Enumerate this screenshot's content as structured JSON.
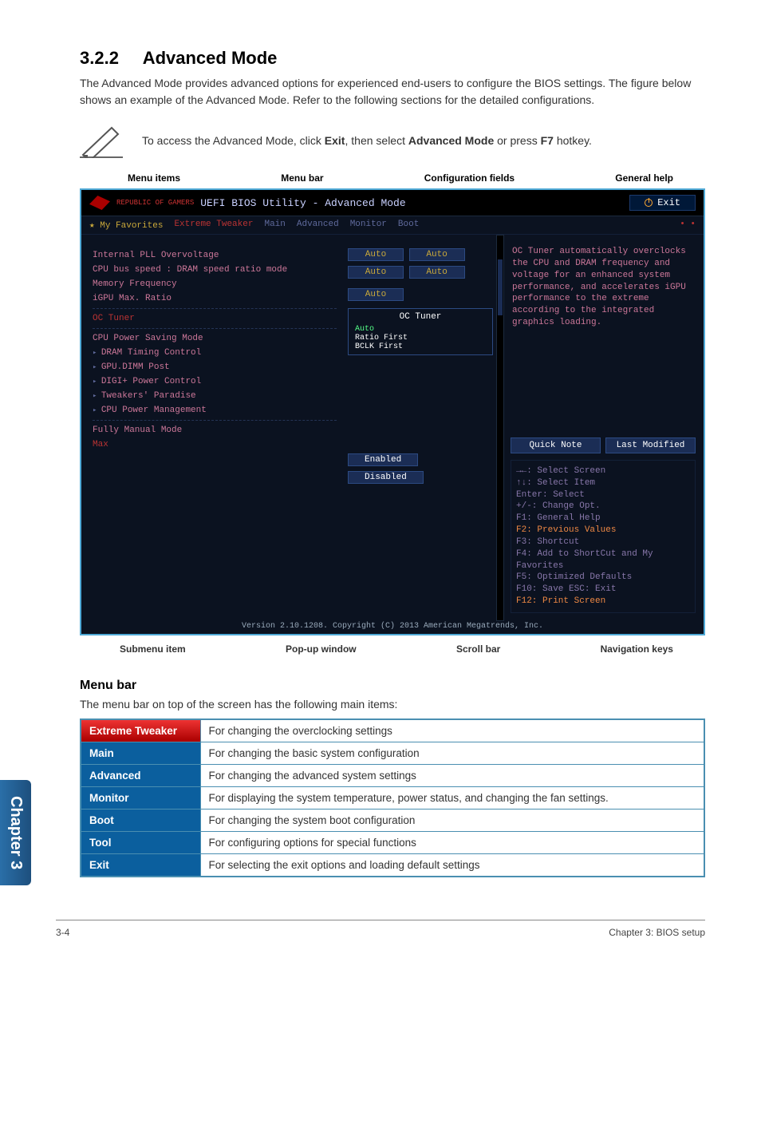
{
  "section_number": "3.2.2",
  "section_title": "Advanced Mode",
  "intro": "The Advanced Mode provides advanced options for experienced end-users to configure the BIOS settings. The figure below shows an example of the Advanced Mode. Refer to the following sections for the detailed configurations.",
  "note": "To access the Advanced Mode, click Exit, then select Advanced Mode or press F7 hotkey.",
  "top_labels": {
    "menu_items": "Menu items",
    "menu_bar": "Menu bar",
    "config_fields": "Configuration fields",
    "general_help": "General help"
  },
  "bios": {
    "brand_small": "REPUBLIC OF\nGAMERS",
    "title": "UEFI BIOS Utility - Advanced Mode",
    "exit": "Exit",
    "menubar": [
      "★ My Favorites",
      "Extreme Tweaker",
      "Main",
      "Advanced",
      "Monitor",
      "Boot"
    ],
    "left_items": [
      "Internal PLL Overvoltage",
      "CPU bus speed : DRAM speed ratio mode",
      "Memory Frequency",
      "iGPU Max. Ratio"
    ],
    "oc_tuner_label": "OC Tuner",
    "cpu_saving": "CPU Power Saving Mode",
    "sub_items": [
      "DRAM Timing Control",
      "GPU.DIMM Post",
      "DIGI+ Power Control",
      "Tweakers' Paradise",
      "CPU Power Management"
    ],
    "fully_manual": "Fully Manual Mode",
    "max_label": "Max",
    "pills": [
      "Auto",
      "Auto",
      "Auto",
      "Auto",
      "Auto"
    ],
    "popup_title": "OC Tuner",
    "popup_lines": [
      "Auto",
      "Ratio First",
      "BCLK First"
    ],
    "enabled": "Enabled",
    "disabled": "Disabled",
    "help_text": "OC Tuner automatically overclocks the CPU and DRAM frequency and voltage for an enhanced system performance, and accelerates iGPU performance to the extreme according to the integrated graphics loading.",
    "quick_note": "Quick Note",
    "last_modified": "Last Modified",
    "nav": [
      "→←: Select Screen",
      "↑↓: Select Item",
      "Enter: Select",
      "+/-: Change Opt.",
      "F1: General Help",
      "F2: Previous Values",
      "F3: Shortcut",
      "F4: Add to ShortCut and My Favorites",
      "F5: Optimized Defaults",
      "F10: Save  ESC: Exit",
      "F12: Print Screen"
    ],
    "footer": "Version 2.10.1208. Copyright (C) 2013 American Megatrends, Inc."
  },
  "bottom_labels": {
    "submenu": "Submenu item",
    "popup": "Pop-up window",
    "scrollbar": "Scroll bar",
    "navkeys": "Navigation keys"
  },
  "menubar_section": {
    "heading": "Menu bar",
    "desc": "The menu bar on top of the screen has the following main items:",
    "rows": [
      {
        "name": "Extreme Tweaker",
        "desc": "For changing the overclocking settings"
      },
      {
        "name": "Main",
        "desc": "For changing the basic system configuration"
      },
      {
        "name": "Advanced",
        "desc": "For changing the advanced system settings"
      },
      {
        "name": "Monitor",
        "desc": "For displaying the system temperature, power status, and changing the fan settings."
      },
      {
        "name": "Boot",
        "desc": "For changing the system boot configuration"
      },
      {
        "name": "Tool",
        "desc": "For configuring options for special functions"
      },
      {
        "name": "Exit",
        "desc": "For selecting the exit options and loading default settings"
      }
    ]
  },
  "chapter_tab": "Chapter 3",
  "footer": {
    "left": "3-4",
    "right": "Chapter 3: BIOS setup"
  }
}
